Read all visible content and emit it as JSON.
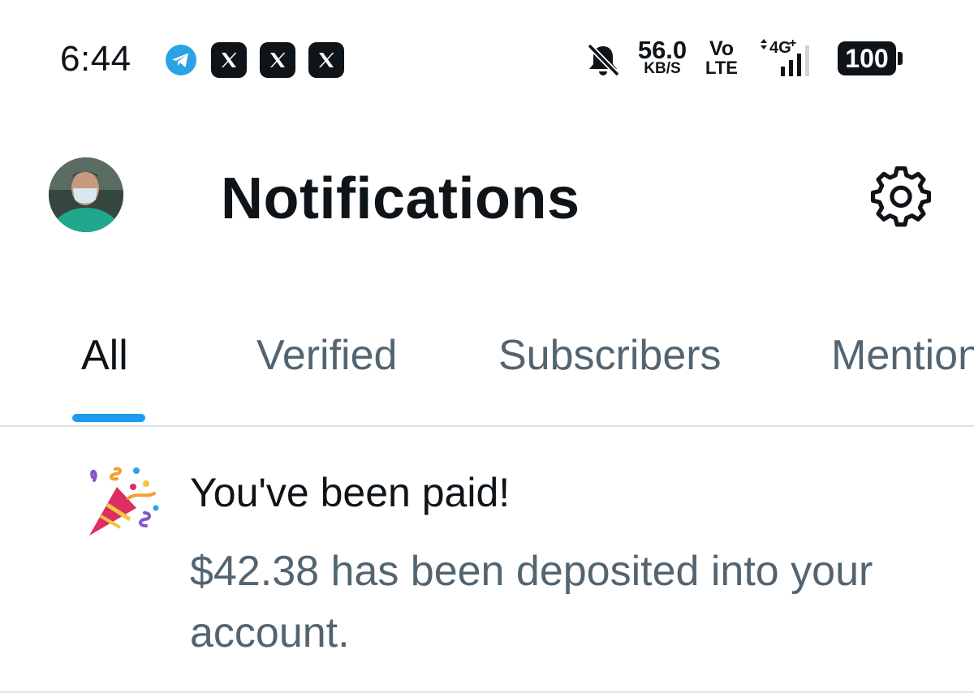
{
  "status_bar": {
    "time": "6:44",
    "net_speed_value": "56.0",
    "net_speed_unit": "KB/S",
    "volte_top": "Vo",
    "volte_bottom": "LTE",
    "network_type": "4G",
    "battery": "100",
    "notification_icons": [
      "telegram-icon",
      "x-app-icon",
      "x-app-icon",
      "x-app-icon"
    ]
  },
  "header": {
    "title": "Notifications",
    "avatar_icon": "avatar",
    "settings_icon": "gear-icon"
  },
  "tabs": [
    {
      "label": "All",
      "active": true
    },
    {
      "label": "Verified",
      "active": false
    },
    {
      "label": "Subscribers",
      "active": false
    },
    {
      "label": "Mentions",
      "active": false
    }
  ],
  "notification": {
    "icon": "party-popper-icon",
    "title": "You've been paid!",
    "body": "$42.38 has been deposited into your account."
  },
  "colors": {
    "accent": "#1d9bf0",
    "text_primary": "#0f1419",
    "text_secondary": "#536471",
    "divider": "#dde3e8"
  }
}
